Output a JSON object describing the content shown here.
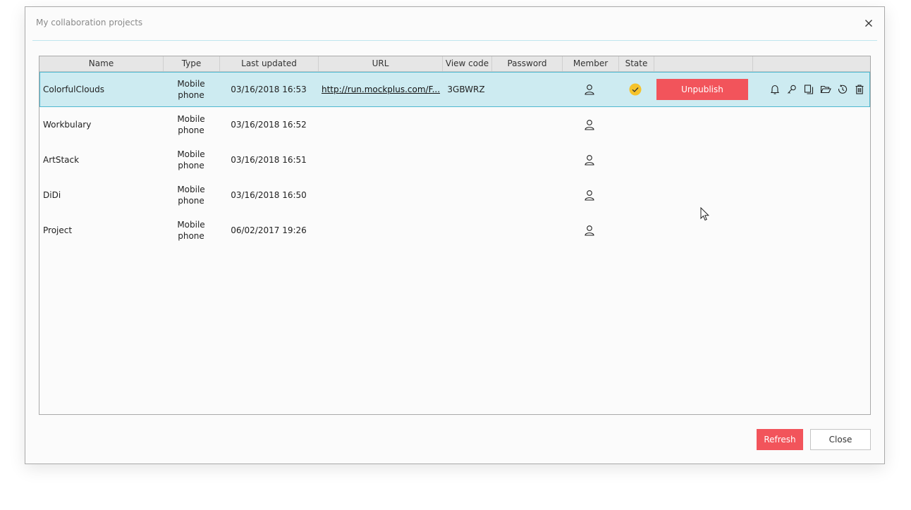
{
  "dialog": {
    "title": "My collaboration projects",
    "close_icon": "close-icon"
  },
  "columns": [
    "Name",
    "Type",
    "Last updated",
    "URL",
    "View code",
    "Password",
    "Member",
    "State",
    "",
    ""
  ],
  "rows": [
    {
      "name": "ColorfulClouds",
      "type_l1": "Mobile",
      "type_l2": "phone",
      "updated": "03/16/2018 16:53",
      "url": "http://run.mockplus.com/F...",
      "view_code": "3GBWRZ",
      "password": "",
      "state": "published"
    },
    {
      "name": "Workbulary",
      "type_l1": "Mobile",
      "type_l2": "phone",
      "updated": "03/16/2018 16:52",
      "url": "",
      "view_code": "",
      "password": ""
    },
    {
      "name": "ArtStack",
      "type_l1": "Mobile",
      "type_l2": "phone",
      "updated": "03/16/2018 16:51",
      "url": "",
      "view_code": "",
      "password": ""
    },
    {
      "name": "DiDi",
      "type_l1": "Mobile",
      "type_l2": "phone",
      "updated": "03/16/2018 16:50",
      "url": "",
      "view_code": "",
      "password": ""
    },
    {
      "name": "Project",
      "type_l1": "Mobile",
      "type_l2": "phone",
      "updated": "06/02/2017 19:26",
      "url": "",
      "view_code": "",
      "password": ""
    }
  ],
  "selected_row_actions": {
    "unpublish_label": "Unpublish",
    "icons": [
      "bell-icon",
      "key-icon",
      "copy-icon",
      "folder-open-icon",
      "history-icon",
      "trash-icon"
    ]
  },
  "footer": {
    "refresh_label": "Refresh",
    "close_label": "Close"
  },
  "colors": {
    "accent": "#f2545b",
    "selection": "#cdebf1",
    "state_ok": "#f5c32b"
  }
}
